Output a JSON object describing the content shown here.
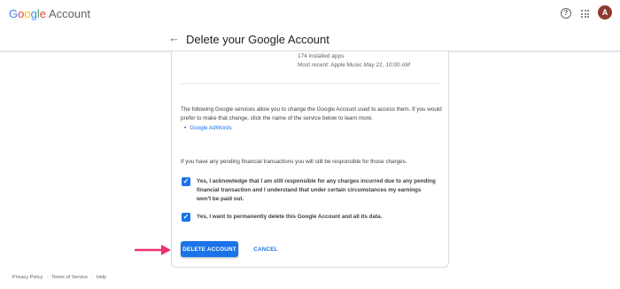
{
  "app": {
    "brand_google": "Google",
    "brand_account": "Account",
    "avatar_initial": "A",
    "icons": {
      "help": "help-circle-icon",
      "apps": "apps-grid-icon"
    }
  },
  "header": {
    "back_icon": "arrow-back-icon",
    "title": "Delete your Google Account"
  },
  "apps_section": {
    "installed": "174 installed apps",
    "recent_prefix": "Most recent: Apple Music",
    "recent_date": "May 21, 10:00 AM"
  },
  "services": {
    "text": "The following Google services allow you to change the Google Account used to access them. If you would prefer to make that change, click the name of the service below to learn more.",
    "items": [
      {
        "label": "Google AdWords"
      }
    ]
  },
  "financial_text": "If you have any pending financial transactions you will still be responsible for those charges.",
  "checkboxes": [
    {
      "checked": true,
      "label": "Yes, I acknowledge that I am still responsible for any charges incurred due to any pending financial transaction and I understand that under certain circumstances my earnings won't be paid out."
    },
    {
      "checked": true,
      "label": "Yes, I want to permanently delete this Google Account and all its data."
    }
  ],
  "buttons": {
    "delete": "DELETE ACCOUNT",
    "cancel": "CANCEL"
  },
  "footer": {
    "links": [
      "Privacy Policy",
      "Terms of Service",
      "Help"
    ]
  },
  "colors": {
    "accent": "#1a73e8",
    "annotation": "#e8336b",
    "avatar_bg": "#8d3b2e"
  }
}
